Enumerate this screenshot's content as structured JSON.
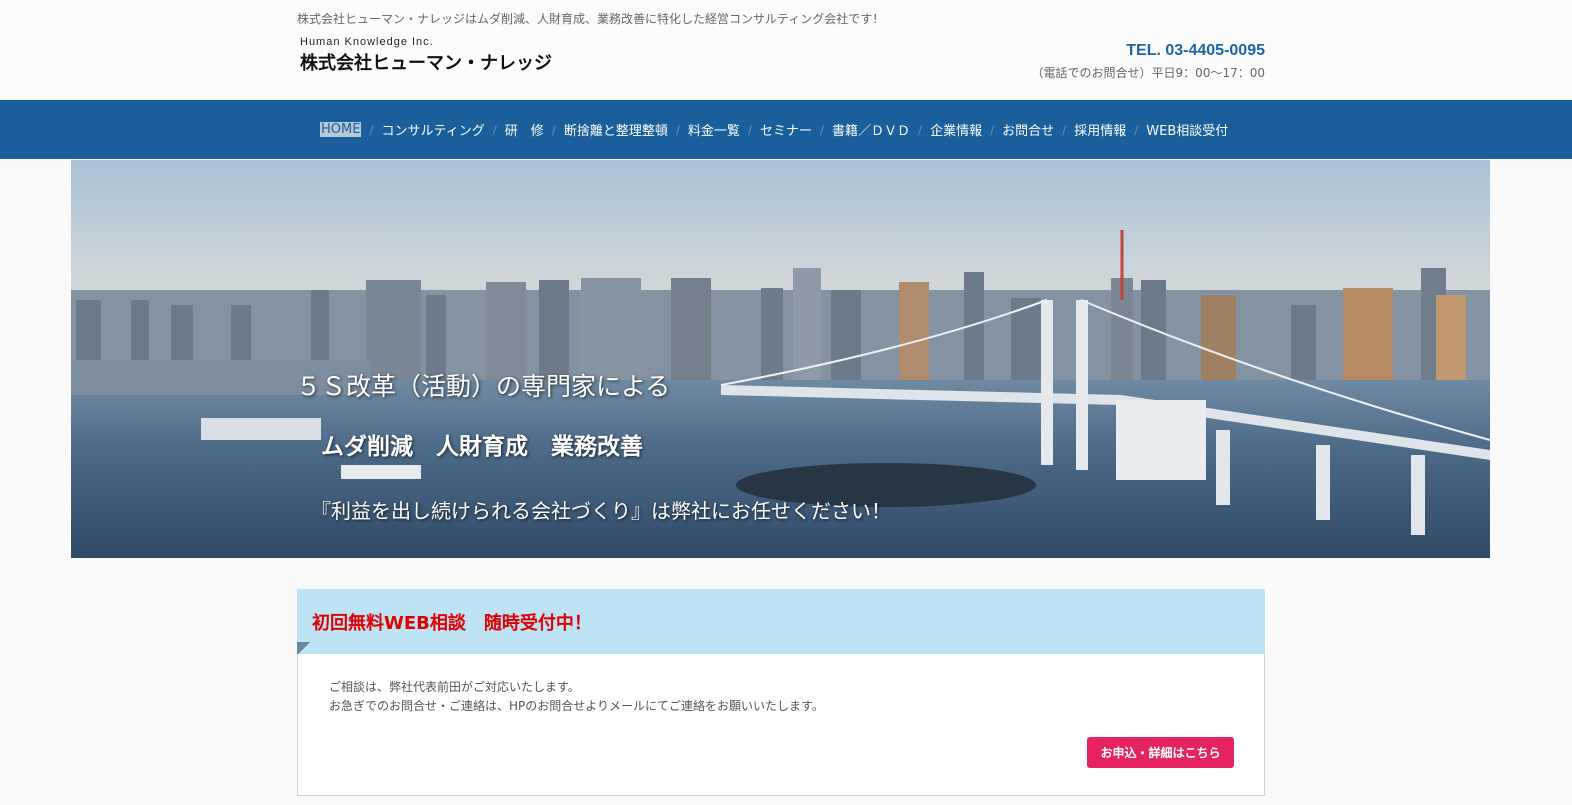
{
  "header": {
    "tagline": "株式会社ヒューマン・ナレッジはムダ削減、人財育成、業務改善に特化した経営コンサルティング会社です！",
    "logo_en": "Human Knowledge Inc.",
    "logo_jp": "株式会社ヒューマン・ナレッジ",
    "tel": "TEL. 03-4405-0095",
    "hours": "（電話でのお問合せ）平日9：00〜17：00"
  },
  "nav": {
    "items": [
      {
        "label": "HOME",
        "active": true
      },
      {
        "label": "コンサルティング"
      },
      {
        "label": "研　修"
      },
      {
        "label": "断捨離と整理整頓"
      },
      {
        "label": "料金一覧"
      },
      {
        "label": "セミナー"
      },
      {
        "label": "書籍／ＤＶＤ"
      },
      {
        "label": "企業情報"
      },
      {
        "label": "お問合せ"
      },
      {
        "label": "採用情報"
      },
      {
        "label": "WEB相談受付"
      }
    ],
    "separator": "/"
  },
  "hero": {
    "line1": "５Ｓ改革（活動）の専門家による",
    "line2": "ムダ削減　人財育成　業務改善",
    "line3": "『利益を出し続けられる会社づくり』は弊社にお任せください！"
  },
  "consult": {
    "title": "初回無料WEB相談　随時受付中！",
    "body_line1": "ご相談は、弊社代表前田がご対応いたします。",
    "body_line2": "お急ぎでのお問合せ・ご連絡は、HPのお問合せよりメールにてご連絡をお願いいたします。",
    "button": "お申込・詳細はこちら"
  },
  "colors": {
    "nav_bg": "#1a5e9c",
    "tel": "#1c64a5",
    "consult_head_bg": "#bde3f5",
    "consult_title": "#e00000",
    "button_bg": "#e5245f"
  }
}
